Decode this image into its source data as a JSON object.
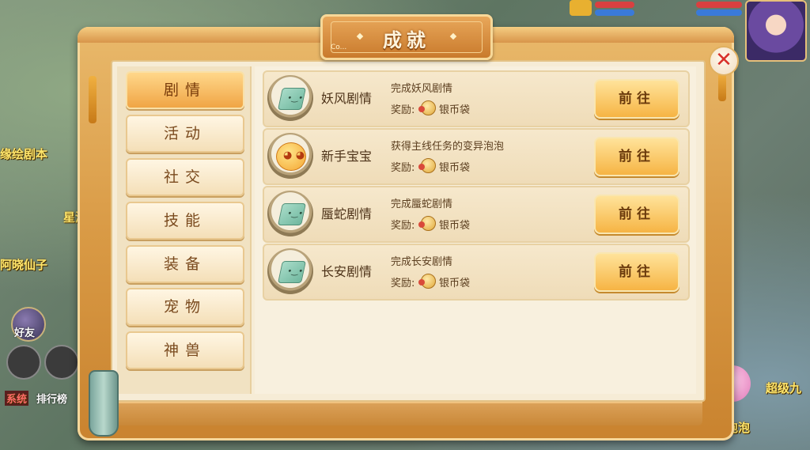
{
  "window": {
    "title": "成就",
    "title_sub": "Co..."
  },
  "background": {
    "labels": [
      "缘绘剧本",
      "星湖",
      "阿晓仙子",
      "超级九",
      "泡泡",
      "排行榜"
    ],
    "friend_label": "好友",
    "system_tag": "系统"
  },
  "categories": [
    {
      "label": "剧情",
      "active": true
    },
    {
      "label": "活动",
      "active": false
    },
    {
      "label": "社交",
      "active": false
    },
    {
      "label": "技能",
      "active": false
    },
    {
      "label": "装备",
      "active": false
    },
    {
      "label": "宠物",
      "active": false
    },
    {
      "label": "神兽",
      "active": false
    }
  ],
  "achievements": [
    {
      "name": "妖风剧情",
      "desc": "完成妖风剧情",
      "reward_label": "奖励:",
      "reward_item": "银币袋",
      "button": "前往",
      "icon": "scroll-icon"
    },
    {
      "name": "新手宝宝",
      "desc": "获得主线任务的变异泡泡",
      "reward_label": "奖励:",
      "reward_item": "银币袋",
      "button": "前往",
      "icon": "pet-blob-icon"
    },
    {
      "name": "蜃蛇剧情",
      "desc": "完成蜃蛇剧情",
      "reward_label": "奖励:",
      "reward_item": "银币袋",
      "button": "前往",
      "icon": "scroll-icon"
    },
    {
      "name": "长安剧情",
      "desc": "完成长安剧情",
      "reward_label": "奖励:",
      "reward_item": "银币袋",
      "button": "前往",
      "icon": "scroll-icon"
    }
  ],
  "close_icon": "close-icon",
  "colors": {
    "accent": "#f0a545",
    "panel": "#f6ecd6",
    "close": "#d8302a"
  }
}
